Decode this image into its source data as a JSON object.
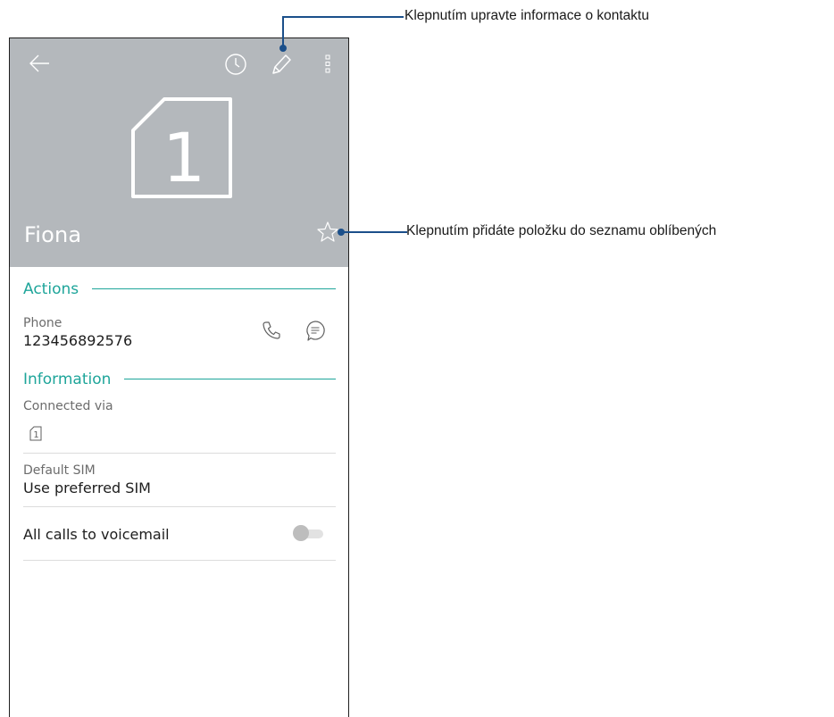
{
  "callouts": {
    "edit": "Klepnutím upravte informace o kontaktu",
    "favorite": "Klepnutím přidáte položku do seznamu oblíbených"
  },
  "header": {
    "contact_name": "Fiona",
    "sim_number": "1",
    "icons": [
      "back-arrow-icon",
      "history-icon",
      "edit-pencil-icon",
      "more-menu-icon",
      "favorite-star-icon"
    ]
  },
  "actions": {
    "title": "Actions",
    "phone_label": "Phone",
    "phone_number": "123456892576"
  },
  "information": {
    "title": "Information",
    "connected_via_label": "Connected via",
    "default_sim_label": "Default SIM",
    "default_sim_value": "Use preferred SIM"
  },
  "voicemail": {
    "label": "All calls to voicemail",
    "enabled": false
  },
  "colors": {
    "header_bg": "#b4b8bc",
    "accent": "#1ea59a",
    "callout": "#1b4f8a"
  }
}
